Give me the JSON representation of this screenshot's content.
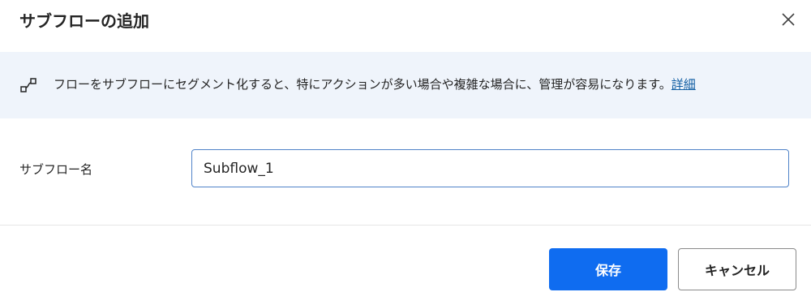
{
  "dialog": {
    "title": "サブフローの追加",
    "close_icon": "close-icon"
  },
  "banner": {
    "icon": "subflow-connector-icon",
    "text": "フローをサブフローにセグメント化すると、特にアクションが多い場合や複雑な場合に、管理が容易になります。",
    "link_label": "詳細"
  },
  "form": {
    "name_label": "サブフロー名",
    "name_value": "Subflow_1"
  },
  "footer": {
    "save_label": "保存",
    "cancel_label": "キャンセル"
  },
  "colors": {
    "primary": "#0f6cf0",
    "banner_bg": "#eff4fb",
    "link": "#115ea3",
    "input_border": "#4f83c8"
  }
}
